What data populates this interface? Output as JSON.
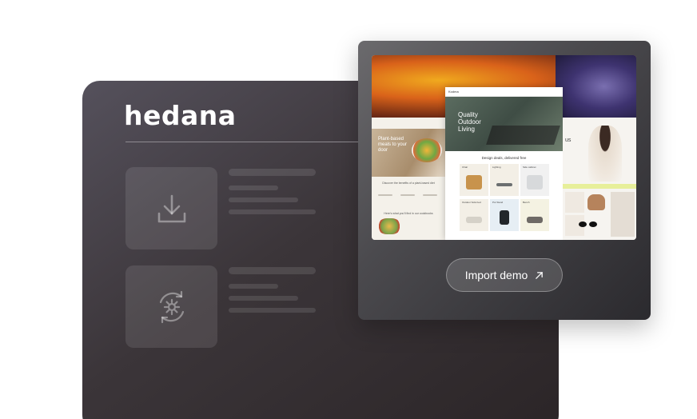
{
  "brand": {
    "logo_text": "hedana"
  },
  "options": [
    {
      "icon": "download-icon"
    },
    {
      "icon": "gear-sync-icon"
    }
  ],
  "preview": {
    "left_site": {
      "hero_text": "Plant-based meals to your door",
      "section_title": "Discover the benefits of a plant-based diet",
      "section_title_2": "Here's what you'll find in our cookbooks"
    },
    "center_site": {
      "brand": "Kodma",
      "hero_title": "Quality Outdoor Living",
      "section_title": "Design deals, delivered free",
      "products": [
        "Chair",
        "Lighting",
        "Side cabinet",
        "Outdoor Sofa bed",
        "Pot Stand",
        "Bench"
      ]
    },
    "right_site": {
      "hero_text": "us"
    }
  },
  "import_button": {
    "label": "Import demo",
    "icon": "arrow-up-right-icon"
  },
  "colors": {
    "panel_dark": "#3b3539",
    "front_panel": "#4b4a4e",
    "button_text": "#ffffff",
    "accent_strip": "#e7ef9a"
  }
}
